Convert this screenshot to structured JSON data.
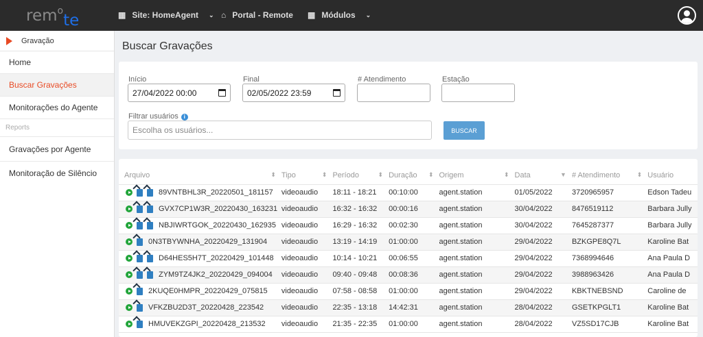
{
  "header": {
    "logo": "remote",
    "site": "Site: HomeAgent",
    "portal": "Portal - Remote",
    "modules": "Módulos"
  },
  "sidebar": {
    "section": "Gravação",
    "items": [
      "Home",
      "Buscar Gravações",
      "Monitorações do Agente"
    ],
    "reports_label": "Reports",
    "report_items": [
      "Gravações por Agente",
      "Monitoração de Silêncio"
    ]
  },
  "page": {
    "title": "Buscar Gravações"
  },
  "filters": {
    "start_label": "Início",
    "start_value": "27/04/2022 00:00",
    "end_label": "Final",
    "end_value": "02/05/2022 23:59",
    "atendimento_label": "# Atendimento",
    "atendimento_value": "",
    "estacao_label": "Estação",
    "estacao_value": "",
    "users_label": "Filtrar usuários",
    "users_placeholder": "Escolha os usuários...",
    "search_button": "BUSCAR"
  },
  "table": {
    "columns": [
      "Arquivo",
      "Tipo",
      "Período",
      "Duração",
      "Origem",
      "Data",
      "# Atendimento",
      "Usuário"
    ],
    "rows": [
      {
        "arquivo": "89VNTBHL3R_20220501_181157",
        "icons": 2,
        "tipo": "videoaudio",
        "periodo": "18:11 - 18:21",
        "duracao": "00:10:00",
        "origem": "agent.station",
        "data": "01/05/2022",
        "atendimento": "3720965957",
        "usuario": "Edson Tadeu"
      },
      {
        "arquivo": "GVX7CP1W3R_20220430_163231",
        "icons": 2,
        "tipo": "videoaudio",
        "periodo": "16:32 - 16:32",
        "duracao": "00:00:16",
        "origem": "agent.station",
        "data": "30/04/2022",
        "atendimento": "8476519112",
        "usuario": "Barbara Jully"
      },
      {
        "arquivo": "NBJIWRTGOK_20220430_162935",
        "icons": 2,
        "tipo": "videoaudio",
        "periodo": "16:29 - 16:32",
        "duracao": "00:02:30",
        "origem": "agent.station",
        "data": "30/04/2022",
        "atendimento": "7645287377",
        "usuario": "Barbara Jully"
      },
      {
        "arquivo": "0N3TBYWNHA_20220429_131904",
        "icons": 1,
        "tipo": "videoaudio",
        "periodo": "13:19 - 14:19",
        "duracao": "01:00:00",
        "origem": "agent.station",
        "data": "29/04/2022",
        "atendimento": "BZKGPE8Q7L",
        "usuario": "Karoline Bat"
      },
      {
        "arquivo": "D64HES5H7T_20220429_101448",
        "icons": 2,
        "tipo": "videoaudio",
        "periodo": "10:14 - 10:21",
        "duracao": "00:06:55",
        "origem": "agent.station",
        "data": "29/04/2022",
        "atendimento": "7368994646",
        "usuario": "Ana Paula D"
      },
      {
        "arquivo": "ZYM9TZ4JK2_20220429_094004",
        "icons": 2,
        "tipo": "videoaudio",
        "periodo": "09:40 - 09:48",
        "duracao": "00:08:36",
        "origem": "agent.station",
        "data": "29/04/2022",
        "atendimento": "3988963426",
        "usuario": "Ana Paula D"
      },
      {
        "arquivo": "2KUQE0HMPR_20220429_075815",
        "icons": 1,
        "tipo": "videoaudio",
        "periodo": "07:58 - 08:58",
        "duracao": "01:00:00",
        "origem": "agent.station",
        "data": "29/04/2022",
        "atendimento": "KBKTNEBSND",
        "usuario": "Caroline de"
      },
      {
        "arquivo": "VFKZBU2D3T_20220428_223542",
        "icons": 1,
        "tipo": "videoaudio",
        "periodo": "22:35 - 13:18",
        "duracao": "14:42:31",
        "origem": "agent.station",
        "data": "28/04/2022",
        "atendimento": "GSETKPGLT1",
        "usuario": "Karoline Bat"
      },
      {
        "arquivo": "HMUVEKZGPI_20220428_213532",
        "icons": 1,
        "tipo": "videoaudio",
        "periodo": "21:35 - 22:35",
        "duracao": "01:00:00",
        "origem": "agent.station",
        "data": "28/04/2022",
        "atendimento": "VZ5SD17CJB",
        "usuario": "Karoline Bat"
      }
    ]
  }
}
